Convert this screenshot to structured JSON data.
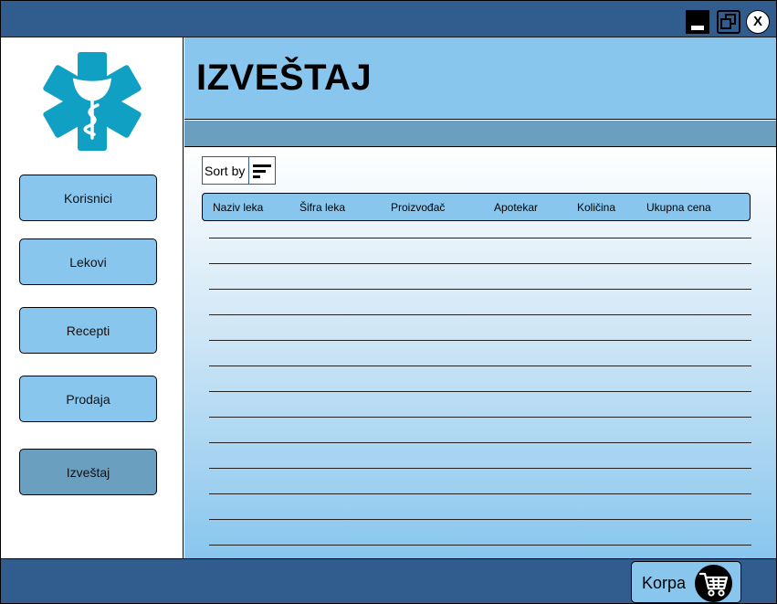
{
  "window": {
    "controls": {
      "minimize": "minimize-icon",
      "restore": "restore-icon",
      "close_label": "X"
    }
  },
  "sidebar": {
    "logo_icon": "star-of-life-icon",
    "items": [
      {
        "label": "Korisnici",
        "active": false
      },
      {
        "label": "Lekovi",
        "active": false
      },
      {
        "label": "Recepti",
        "active": false
      },
      {
        "label": "Prodaja",
        "active": false
      },
      {
        "label": "Izveštaj",
        "active": true
      }
    ]
  },
  "header": {
    "title": "IZVEŠTAJ"
  },
  "toolbar": {
    "sort_label": "Sort by",
    "sort_icon": "sort-lines-icon"
  },
  "table": {
    "columns": [
      "Naziv leka",
      "Šifra leka",
      "Proizvođač",
      "Apotekar",
      "Količina",
      "Ukupna cena"
    ],
    "rows": []
  },
  "footer": {
    "cart_label": "Korpa",
    "cart_icon": "shopping-cart-icon"
  },
  "colors": {
    "titlebar": "#305d8e",
    "accent_light": "#88c6ee",
    "accent_mid": "#6b9fc0",
    "logo": "#0fa0c4"
  }
}
